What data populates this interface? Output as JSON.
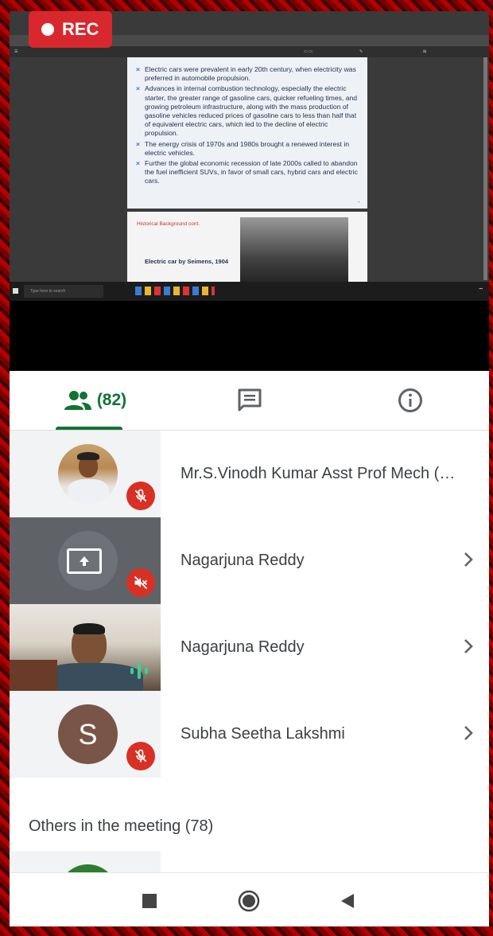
{
  "recording": {
    "label": "REC"
  },
  "shared_screen": {
    "slide_bullets": [
      "Electric cars were prevalent in early 20th century, when electricity was preferred in automobile propulsion.",
      "Advances in internal combustion technology, especially the electric starter, the greater range of gasoline cars, quicker refueling times, and growing petroleum infrastructure, along with the mass production of gasoline vehicles reduced prices of gasoline cars to less than half that of equivalent electric cars, which led to the decline of electric propulsion.",
      "The energy crisis of 1970s and 1980s brought a renewed interest in electric vehicles.",
      "Further the global economic recession of late 2000s called to abandon the fuel inefficient SUVs, in favor of small cars, hybrid cars and electric cars."
    ],
    "slide2_heading": "Historical Background cont.",
    "slide2_caption": "Electric car by Seimens, 1904",
    "taskbar_search": "Type here to search"
  },
  "tabs": {
    "people_count": "(82)"
  },
  "participants": [
    {
      "name": "Mr.S.Vinodh Kumar Asst Prof Mech (…"
    },
    {
      "name": "Nagarjuna Reddy"
    },
    {
      "name": "Nagarjuna Reddy"
    },
    {
      "name": "Subha Seetha Lakshmi",
      "initial": "S"
    }
  ],
  "others_section": {
    "title": "Others in the meeting (78)"
  },
  "colors": {
    "accent": "#137333",
    "mute": "#d93025",
    "avatar_s": "#795548",
    "avatar_green": "#2e7d32"
  }
}
